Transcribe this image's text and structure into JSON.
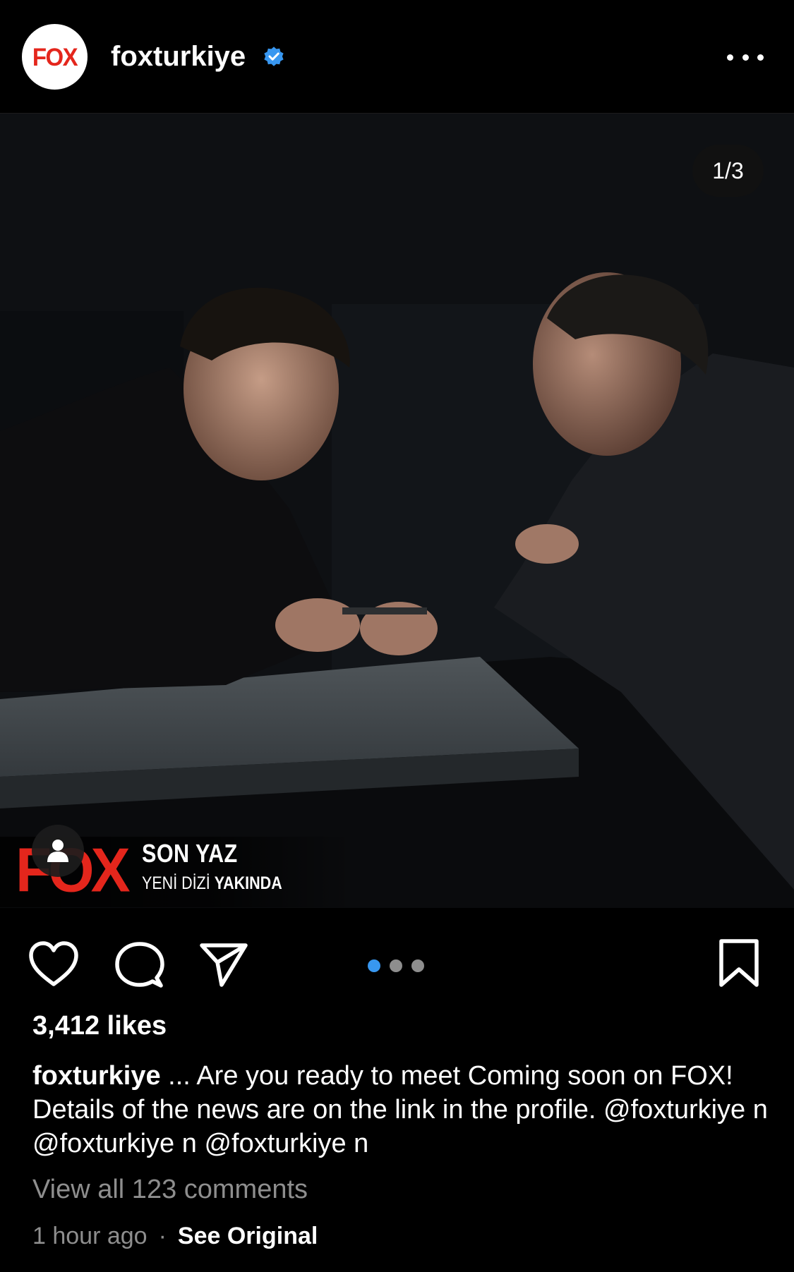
{
  "header": {
    "avatar_text": "FOX",
    "username": "foxturkiye",
    "verified_icon": "verified-badge-icon",
    "more_icon": "more-options-icon"
  },
  "post": {
    "counter": "1/3",
    "brand_logo": "FOX",
    "show_title": "SON YAZ",
    "show_subtitle_light": "YENİ DİZİ",
    "show_subtitle_bold": "YAKINDA",
    "user_tag_icon": "user-tag-icon",
    "carousel": {
      "count": 3,
      "active_index": 0
    }
  },
  "actions": {
    "like_icon": "heart-icon",
    "comment_icon": "comment-icon",
    "share_icon": "share-icon",
    "save_icon": "bookmark-icon"
  },
  "likes": "3,412 likes",
  "caption": {
    "username": "foxturkiye",
    "text": " ... Are you ready to meet Coming soon on FOX! Details of the news are on the link in the profile. @foxturkiye n @foxturkiye n @foxturkiye n"
  },
  "comments_link": "View all 123 comments",
  "timestamp": "1 hour ago",
  "separator": "·",
  "see_original": "See Original",
  "colors": {
    "background": "#000000",
    "brand_red": "#e4261c",
    "verified_blue": "#3897f0",
    "muted_text": "#8e8e8e"
  }
}
